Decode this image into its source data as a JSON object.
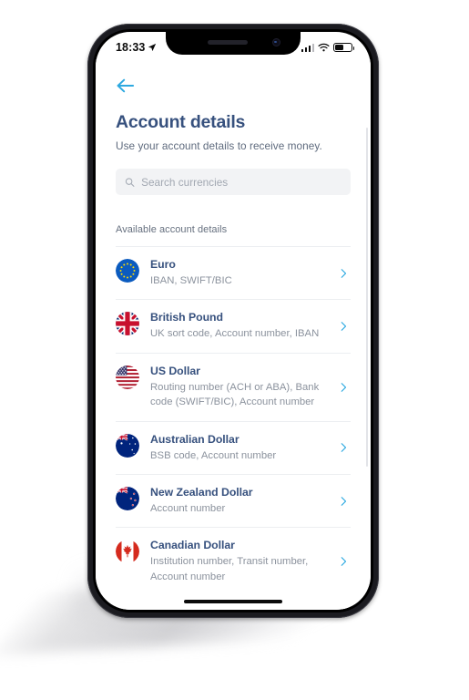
{
  "status_bar": {
    "time": "18:33",
    "location_icon": "location-arrow-icon",
    "signal_icon": "cellular-signal-icon",
    "wifi_icon": "wifi-icon",
    "battery_icon": "battery-icon"
  },
  "header": {
    "back_icon": "back-arrow-icon",
    "title": "Account details",
    "subtitle": "Use your account details to receive money."
  },
  "search": {
    "icon": "search-icon",
    "placeholder": "Search currencies",
    "value": ""
  },
  "section": {
    "label": "Available account details"
  },
  "colors": {
    "title_navy": "#37517e",
    "accent_blue": "#2ea9e0",
    "subtitle_gray": "#8b929d",
    "search_bg": "#f2f3f5",
    "divider": "#eceef1"
  },
  "currencies": [
    {
      "name": "Euro",
      "details": "IBAN, SWIFT/BIC",
      "flag": "flag-european-union",
      "chevron": "chevron-right-icon"
    },
    {
      "name": "British Pound",
      "details": "UK sort code, Account number, IBAN",
      "flag": "flag-united-kingdom",
      "chevron": "chevron-right-icon"
    },
    {
      "name": "US Dollar",
      "details": "Routing number (ACH or ABA), Bank code (SWIFT/BIC), Account number",
      "flag": "flag-united-states",
      "chevron": "chevron-right-icon"
    },
    {
      "name": "Australian Dollar",
      "details": "BSB code, Account number",
      "flag": "flag-australia",
      "chevron": "chevron-right-icon"
    },
    {
      "name": "New Zealand Dollar",
      "details": "Account number",
      "flag": "flag-new-zealand",
      "chevron": "chevron-right-icon"
    },
    {
      "name": "Canadian Dollar",
      "details": "Institution number, Transit number, Account number",
      "flag": "flag-canada",
      "chevron": "chevron-right-icon"
    }
  ]
}
